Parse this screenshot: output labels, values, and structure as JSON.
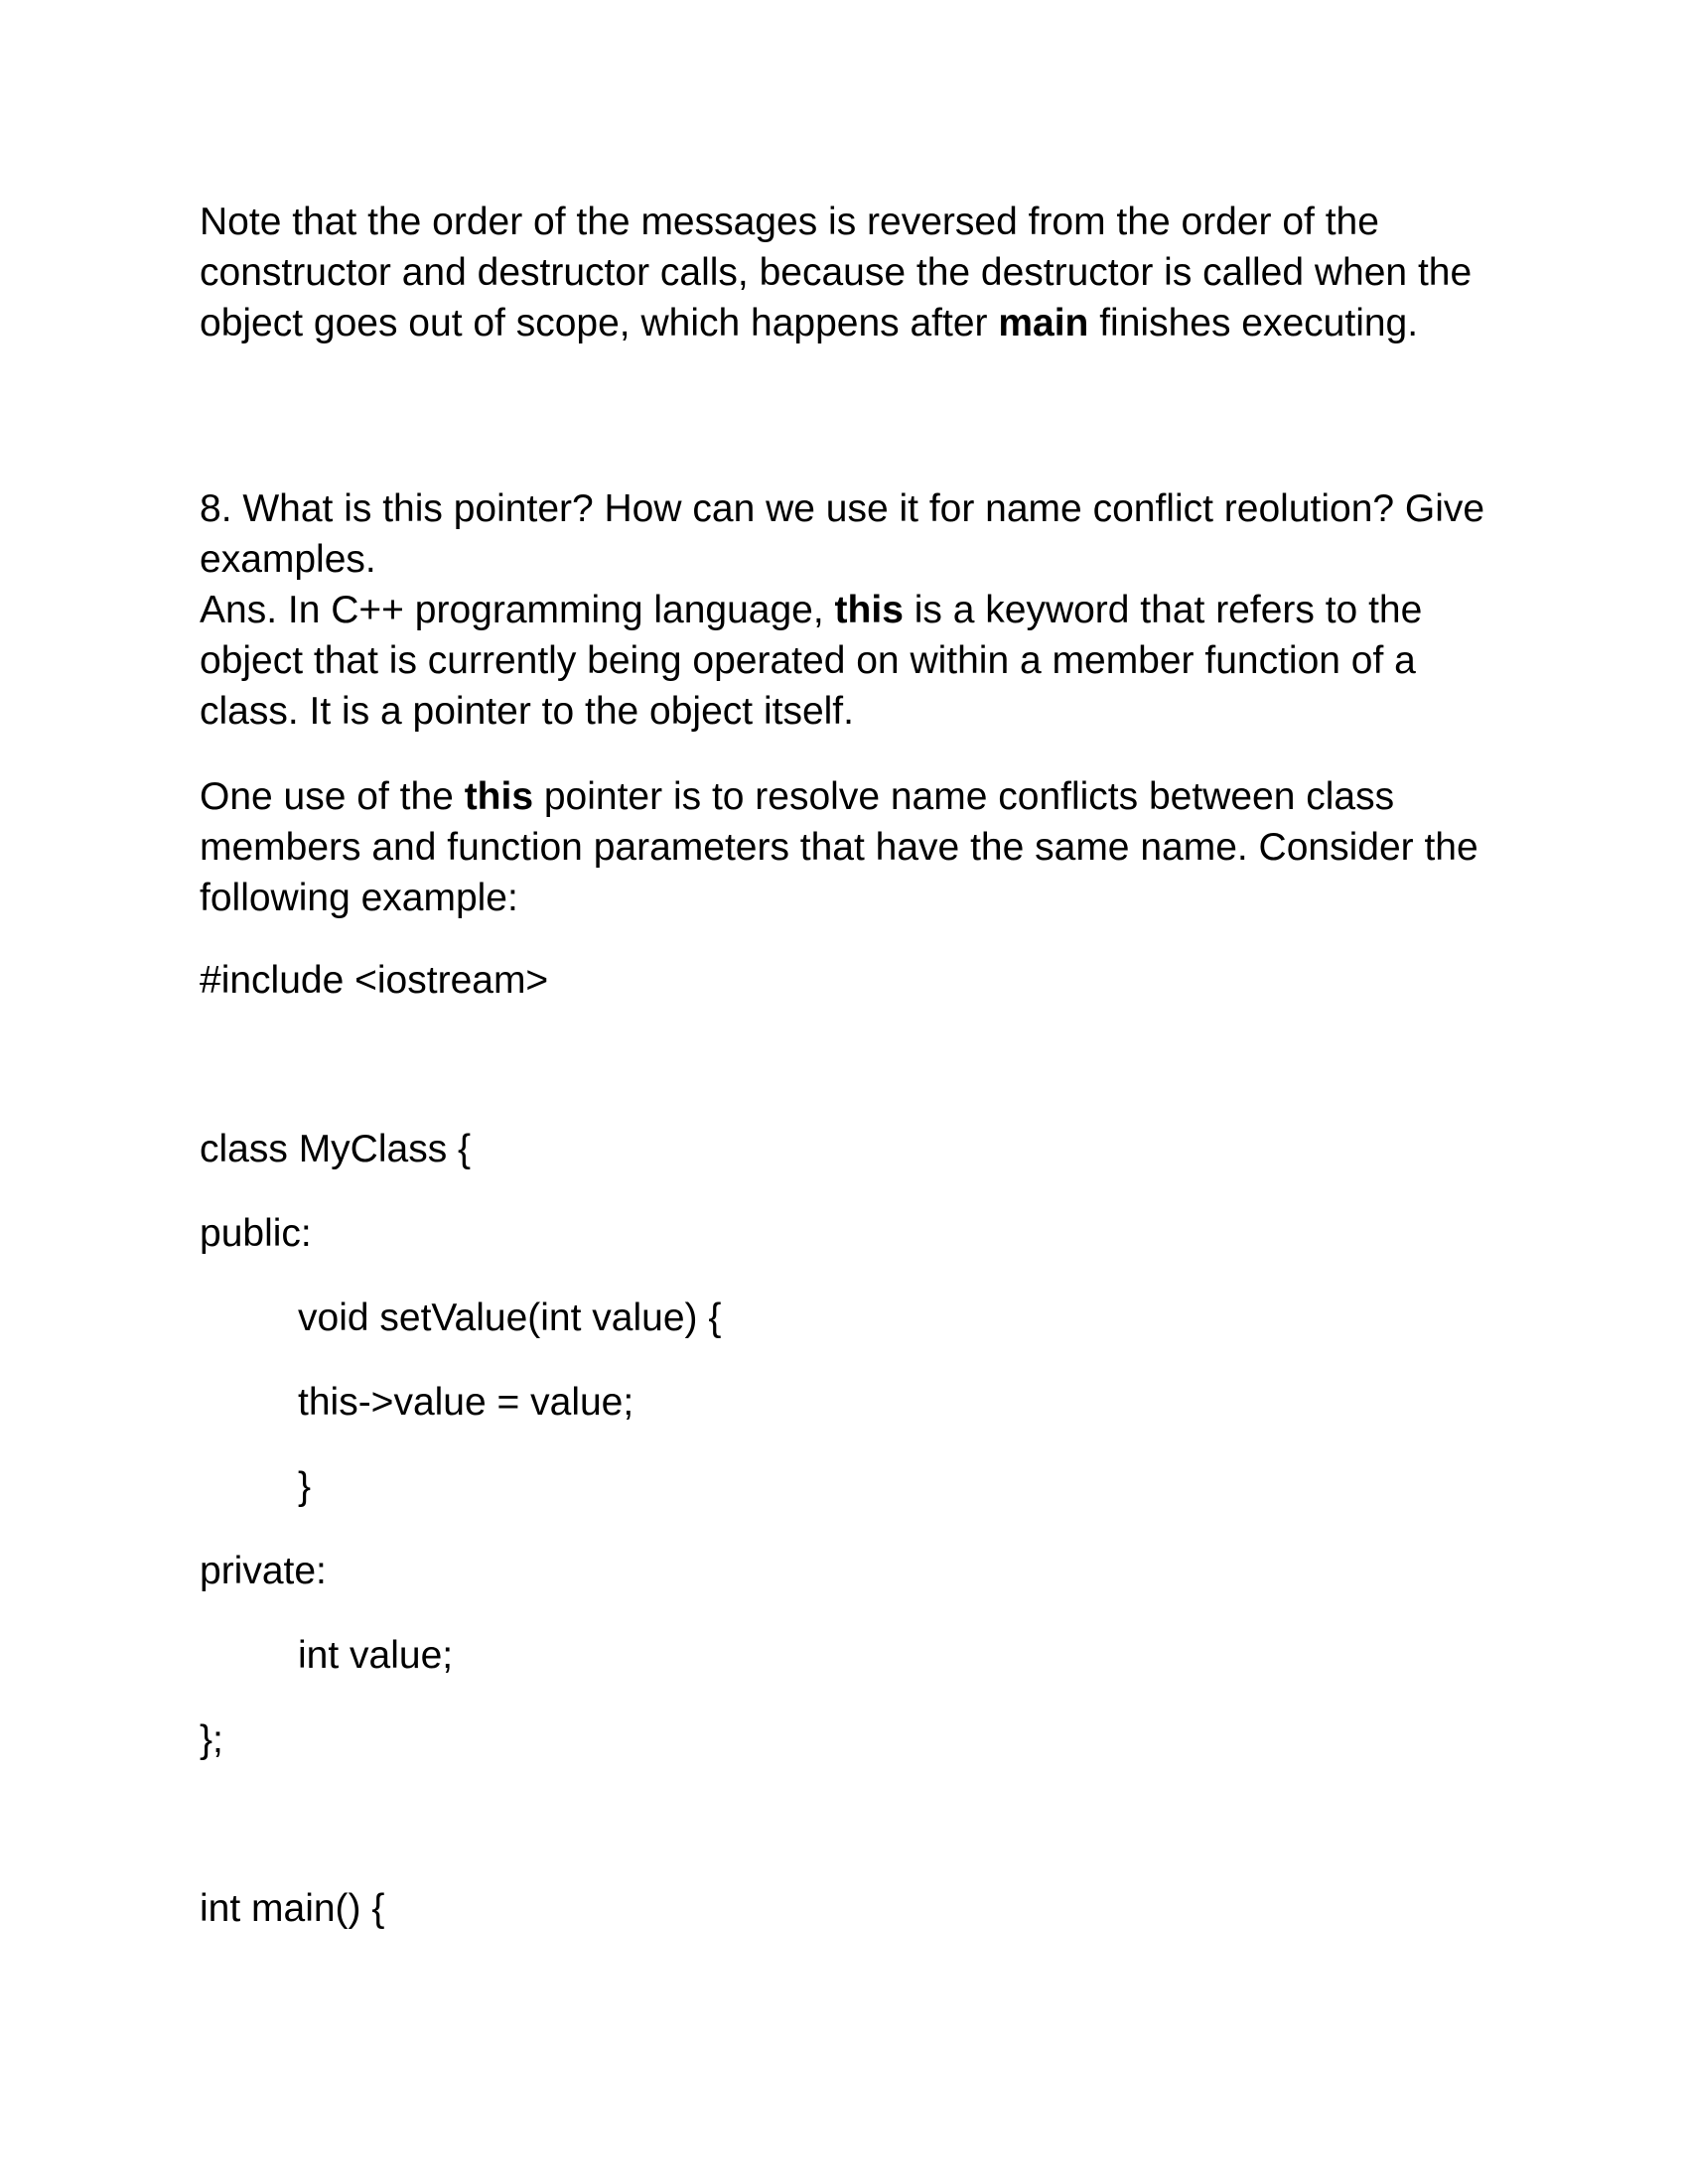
{
  "paragraph_1": {
    "line1": "Note that the order of the messages is reversed from the order of the",
    "line2": "constructor and destructor calls, because the destructor is called when the",
    "line3_before": "object goes out of scope, which happens after ",
    "line3_bold": "main",
    "line3_after": " finishes executing."
  },
  "question_8": {
    "line1": "8. What is this pointer? How can we use it for name conflict reolution? Give",
    "line2": "examples."
  },
  "answer_8": {
    "line1_before": "Ans. In C++ programming language, ",
    "line1_bold": "this",
    "line1_after": " is a keyword that refers to the",
    "line2": "object that is currently being operated on within a member function of a",
    "line3": "class. It is a pointer to the object itself."
  },
  "paragraph_2": {
    "line1_before": "One use of the ",
    "line1_bold": "this",
    "line1_after": " pointer is to resolve name conflicts between class",
    "line2": "members and function parameters that have the same name. Consider the",
    "line3": "following example:"
  },
  "code": {
    "include": "#include <iostream>",
    "class_decl": "class MyClass {",
    "public_label": "public:",
    "set_value_sig": "void setValue(int value) {",
    "assignment": "this->value = value;",
    "close_brace_fn": "}",
    "private_label": "private:",
    "member_decl": "int value;",
    "class_end": "};",
    "main_sig": "int main() {"
  }
}
